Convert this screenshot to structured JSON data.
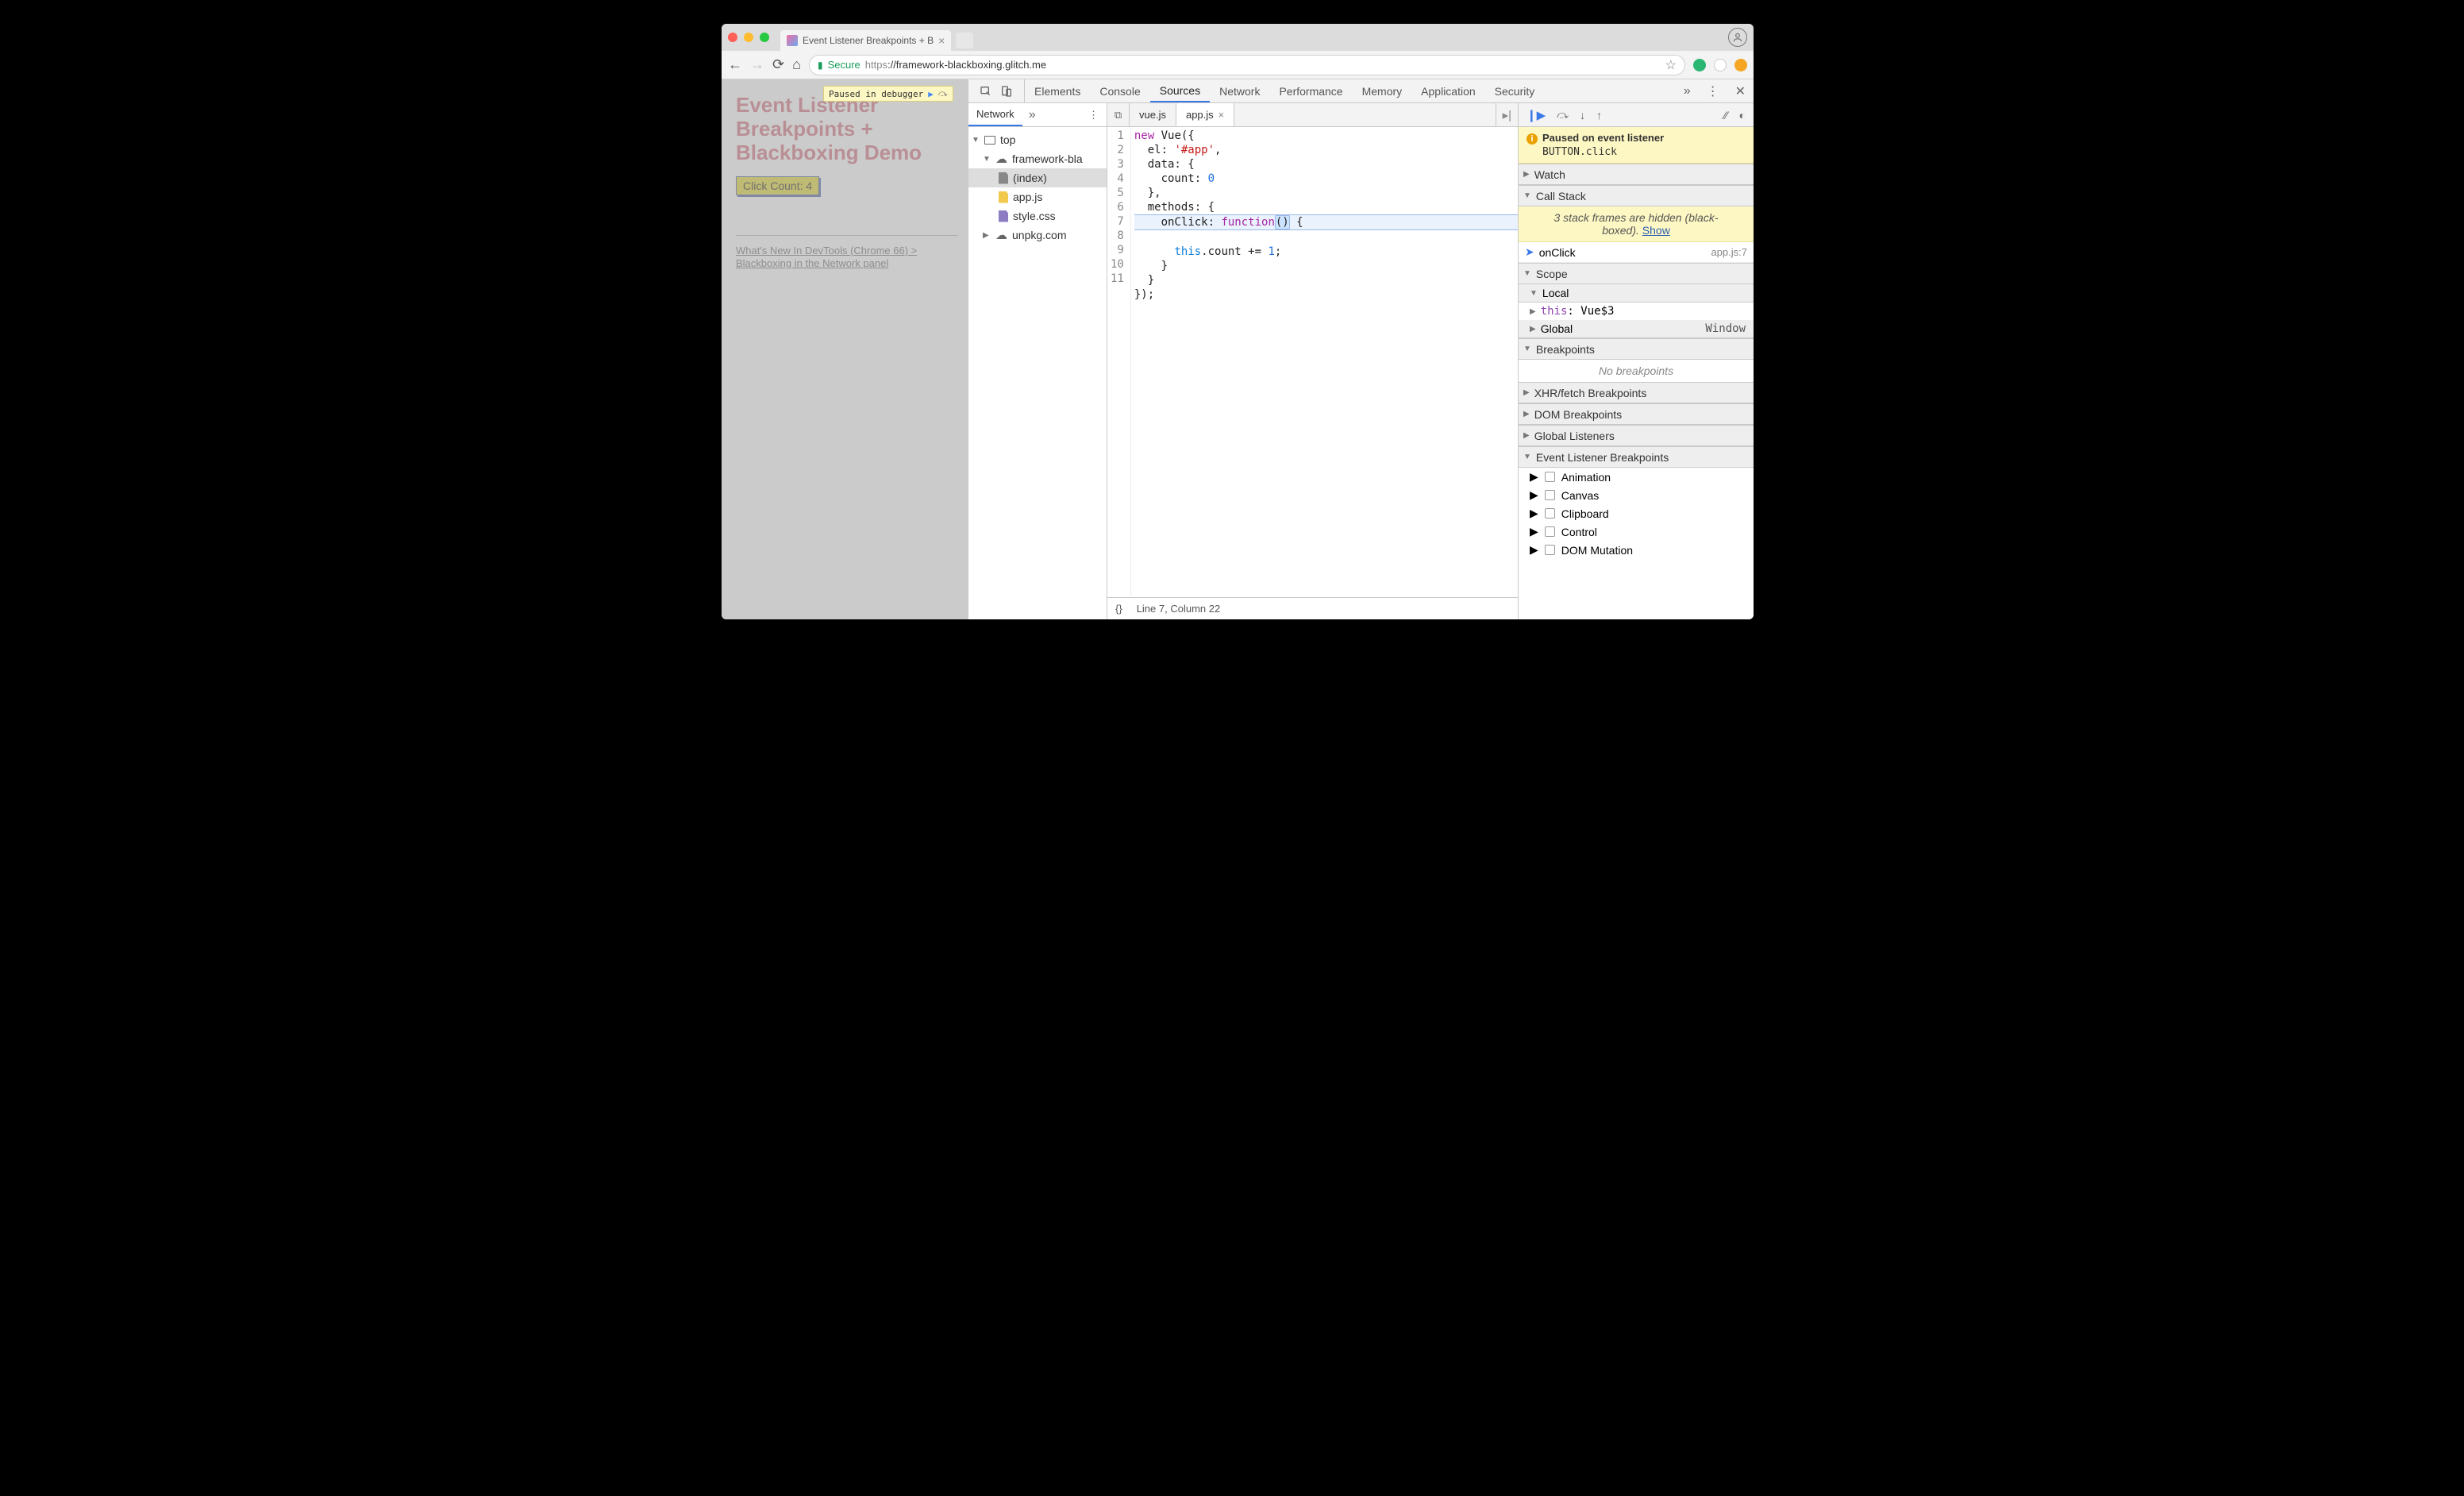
{
  "browser": {
    "tab_title": "Event Listener Breakpoints + B",
    "secure_label": "Secure",
    "url_scheme": "https",
    "url_rest": "://framework-blackboxing.glitch.me"
  },
  "page": {
    "paused_badge": "Paused in debugger",
    "heading": "Event Listener Breakpoints + Blackboxing Demo",
    "button_label": "Click Count: 4",
    "link_text": "What's New In DevTools (Chrome 66) > Blackboxing in the Network panel"
  },
  "devtools": {
    "tabs": [
      "Elements",
      "Console",
      "Sources",
      "Network",
      "Performance",
      "Memory",
      "Application",
      "Security"
    ],
    "active_tab": "Sources",
    "navigator": {
      "tab": "Network",
      "tree": {
        "top": "top",
        "domain": "framework-bla",
        "files": [
          "(index)",
          "app.js",
          "style.css"
        ],
        "other_domain": "unpkg.com"
      }
    },
    "editor": {
      "open_tabs": [
        "vue.js",
        "app.js"
      ],
      "active_tab": "app.js",
      "lines": [
        "new Vue({",
        "  el: '#app',",
        "  data: {",
        "    count: 0",
        "  },",
        "  methods: {",
        "    onClick: function() {",
        "      this.count += 1;",
        "    }",
        "  }",
        "});"
      ],
      "status": {
        "braces": "{}",
        "pos": "Line 7, Column 22"
      }
    },
    "debug": {
      "paused_title": "Paused on event listener",
      "paused_detail": "BUTTON.click",
      "sections": {
        "watch": "Watch",
        "callstack": "Call Stack",
        "scope": "Scope",
        "breakpoints": "Breakpoints",
        "xhr": "XHR/fetch Breakpoints",
        "dom": "DOM Breakpoints",
        "global_listeners": "Global Listeners",
        "event_bp": "Event Listener Breakpoints"
      },
      "callstack_hidden": "3 stack frames are hidden (black-boxed).",
      "callstack_show": "Show",
      "callstack_frame": {
        "name": "onClick",
        "loc": "app.js:7"
      },
      "scope": {
        "local": "Local",
        "this_label": "this",
        "this_value": "Vue$3",
        "global": "Global",
        "global_value": "Window"
      },
      "no_breakpoints": "No breakpoints",
      "event_categories": [
        "Animation",
        "Canvas",
        "Clipboard",
        "Control",
        "DOM Mutation"
      ]
    }
  }
}
